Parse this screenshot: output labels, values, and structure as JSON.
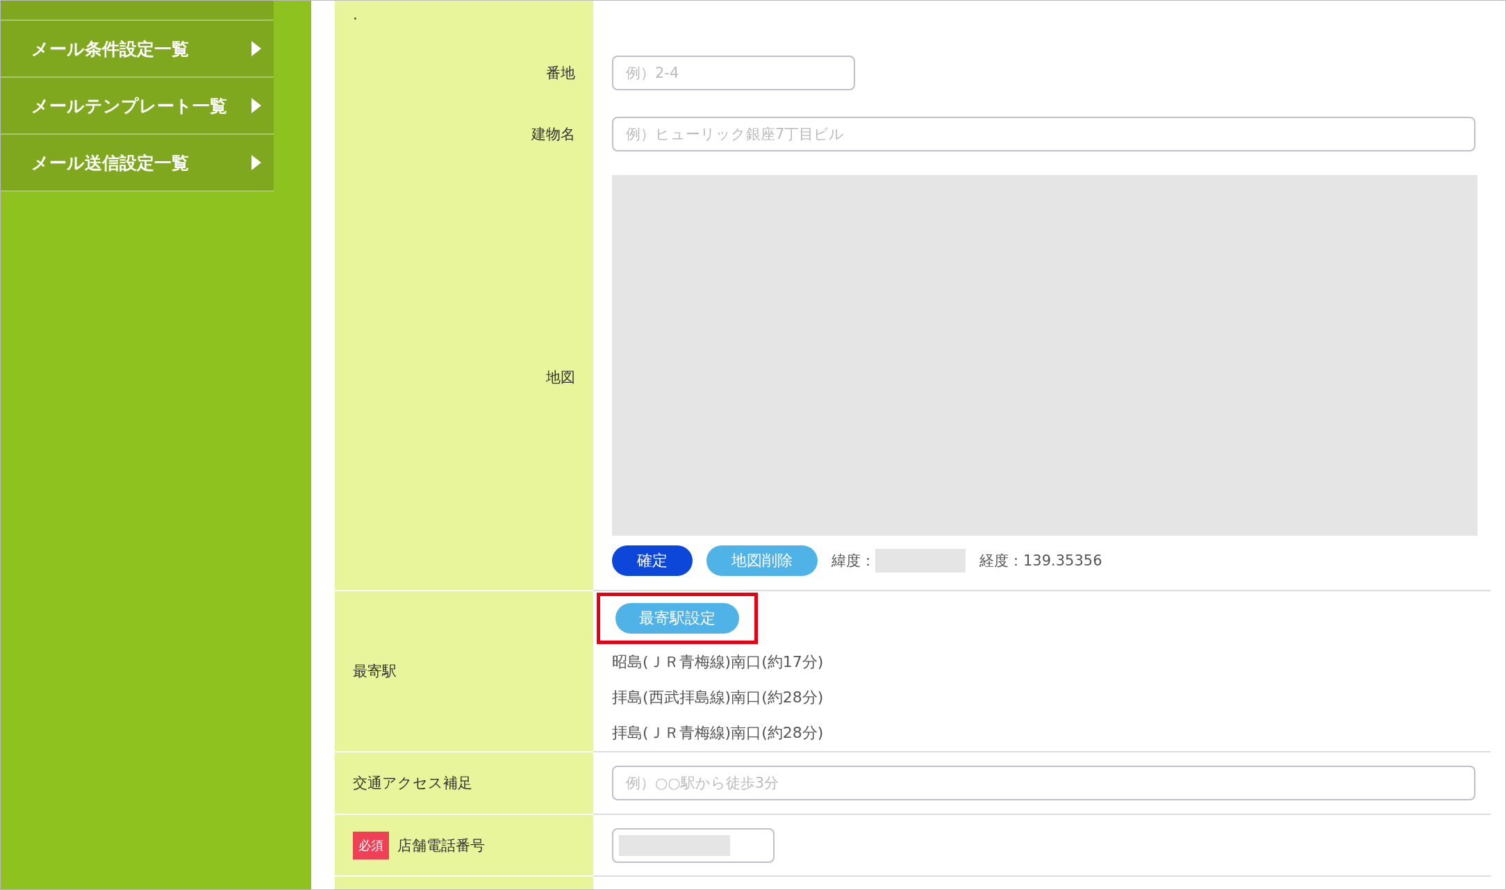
{
  "sidebar": {
    "items": [
      {
        "label": "メール条件設定一覧"
      },
      {
        "label": "メールテンプレート一覧"
      },
      {
        "label": "メール送信設定一覧"
      }
    ]
  },
  "address": {
    "dot": ".",
    "fields": [
      {
        "label": "番地",
        "placeholder": "例）2-4"
      },
      {
        "label": "建物名",
        "placeholder": "例）ヒューリック銀座7丁目ビル"
      }
    ]
  },
  "map": {
    "label": "地図",
    "buttons": [
      {
        "label": "確定",
        "kind": "primary"
      },
      {
        "label": "地図削除",
        "kind": "secondary"
      }
    ],
    "latitude_label": "緯度：",
    "longitude": "経度：139.35356"
  },
  "nearest_station": {
    "label": "最寄駅",
    "button": "最寄駅設定",
    "highlighted": true,
    "stations": [
      "昭島(ＪＲ青梅線)南口(約17分)",
      "拝島(西武拝島線)南口(約28分)",
      "拝島(ＪＲ青梅線)南口(約28分)"
    ]
  },
  "access_note": {
    "label": "交通アクセス補足",
    "placeholder": "例）○○駅から徒歩3分"
  },
  "phone": {
    "label": "店舗電話番号",
    "badge": "必須",
    "required": true
  }
}
